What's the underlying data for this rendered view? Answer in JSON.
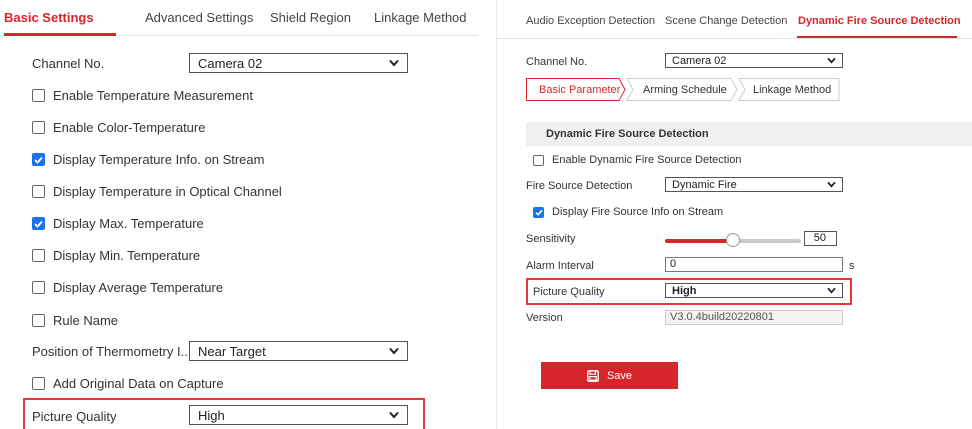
{
  "left": {
    "tabs": [
      {
        "label": "Basic Settings",
        "active": true
      },
      {
        "label": "Advanced Settings",
        "active": false
      },
      {
        "label": "Shield Region",
        "active": false
      },
      {
        "label": "Linkage Method",
        "active": false
      }
    ],
    "channel": {
      "label": "Channel No.",
      "value": "Camera 02"
    },
    "checkboxes": [
      {
        "label": "Enable Temperature Measurement",
        "checked": false
      },
      {
        "label": "Enable Color-Temperature",
        "checked": false
      },
      {
        "label": "Display Temperature Info. on Stream",
        "checked": true
      },
      {
        "label": "Display Temperature in Optical Channel",
        "checked": false
      },
      {
        "label": "Display Max. Temperature",
        "checked": true
      },
      {
        "label": "Display Min. Temperature",
        "checked": false
      },
      {
        "label": "Display Average Temperature",
        "checked": false
      },
      {
        "label": "Rule Name",
        "checked": false
      }
    ],
    "position": {
      "label": "Position of Thermometry I...",
      "value": "Near Target"
    },
    "add_original": {
      "label": "Add Original Data on Capture",
      "checked": false
    },
    "picture_quality": {
      "label": "Picture Quality",
      "value": "High"
    }
  },
  "right": {
    "tabs": [
      {
        "label": "Audio Exception Detection",
        "active": false
      },
      {
        "label": "Scene Change Detection",
        "active": false
      },
      {
        "label": "Dynamic Fire Source Detection",
        "active": true
      }
    ],
    "channel": {
      "label": "Channel No.",
      "value": "Camera 02"
    },
    "subtabs": [
      {
        "label": "Basic Parameter",
        "active": true
      },
      {
        "label": "Arming Schedule",
        "active": false
      },
      {
        "label": "Linkage Method",
        "active": false
      }
    ],
    "section_title": "Dynamic Fire Source Detection",
    "enable_dynamic": {
      "label": "Enable Dynamic Fire Source Detection",
      "checked": false
    },
    "fire_source": {
      "label": "Fire Source Detection",
      "value": "Dynamic Fire"
    },
    "display_fire": {
      "label": "Display Fire Source Info on Stream",
      "checked": true
    },
    "sensitivity": {
      "label": "Sensitivity",
      "value": "50",
      "fraction": 0.5
    },
    "alarm_interval": {
      "label": "Alarm Interval",
      "value": "0",
      "unit": "s"
    },
    "picture_quality": {
      "label": "Picture Quality",
      "value": "High"
    },
    "version": {
      "label": "Version",
      "value": "V3.0.4build20220801"
    },
    "save_label": "Save"
  },
  "colors": {
    "accent": "#d6262c",
    "checkbox": "#1a73e8",
    "highlight": "#e53935"
  }
}
